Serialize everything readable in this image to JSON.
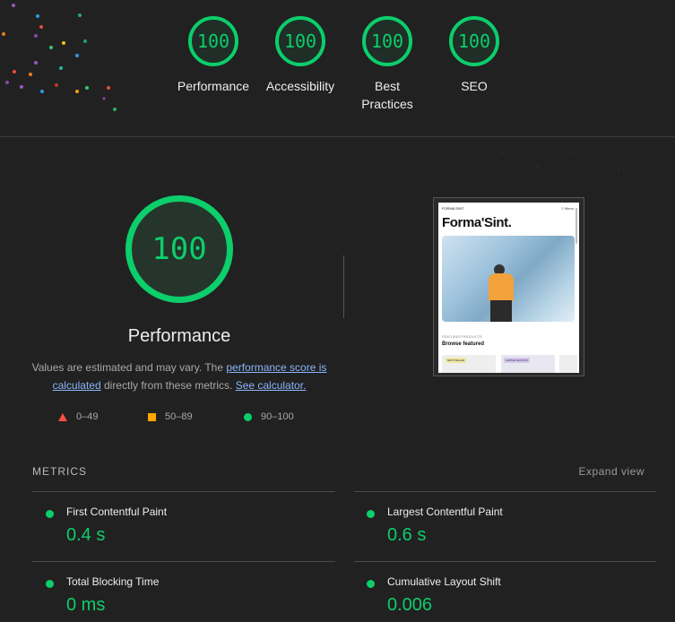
{
  "categories": [
    {
      "score": "100",
      "label": "Performance"
    },
    {
      "score": "100",
      "label": "Accessibility"
    },
    {
      "score": "100",
      "label": "Best Practices"
    },
    {
      "score": "100",
      "label": "SEO"
    }
  ],
  "performance": {
    "score": "100",
    "title": "Performance",
    "desc_part1": "Values are estimated and may vary. The ",
    "desc_link1": "performance score is calculated",
    "desc_part2": " directly from these metrics. ",
    "desc_link2": "See calculator."
  },
  "legend": [
    {
      "range": "0–49",
      "color": "#ff4e42",
      "shape": "triangle"
    },
    {
      "range": "50–89",
      "color": "#ffa400",
      "shape": "square"
    },
    {
      "range": "90–100",
      "color": "#0cce6b",
      "shape": "circle"
    }
  ],
  "screenshot": {
    "brand": "FORMA'SINT.",
    "menu": "≡ Menu",
    "headline": "Forma'Sint.",
    "section_small": "FEATURED PRODUCTS",
    "section_title": "Browse featured",
    "tag1": "BESTSELLER",
    "tag2": "LIMITED EDITION"
  },
  "metrics": {
    "heading": "METRICS",
    "expand_label": "Expand view",
    "items": [
      {
        "name": "First Contentful Paint",
        "value": "0.4 s"
      },
      {
        "name": "Largest Contentful Paint",
        "value": "0.6 s"
      },
      {
        "name": "Total Blocking Time",
        "value": "0 ms"
      },
      {
        "name": "Cumulative Layout Shift",
        "value": "0.006"
      }
    ]
  },
  "colors": {
    "pass": "#0cce6b",
    "average": "#ffa400",
    "fail": "#ff4e42",
    "link": "#8ab4f8",
    "background": "#212121"
  }
}
